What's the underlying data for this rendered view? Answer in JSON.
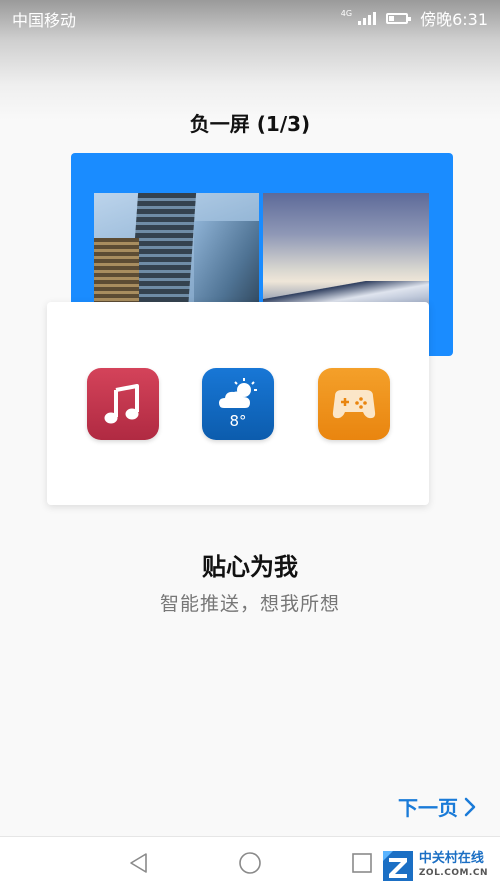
{
  "status_bar": {
    "carrier": "中国移动",
    "network_type": "4G",
    "time": "傍晚6:31",
    "battery_level": 0.3,
    "signal_bars": 4
  },
  "page": {
    "title": "负一屏 (1/3)",
    "headline": "贴心为我",
    "subline": "智能推送，想我所想",
    "next_label": "下一页",
    "accent_color": "#1a8cff"
  },
  "illustration": {
    "apps": [
      {
        "name": "music-icon",
        "color": "#c8364f"
      },
      {
        "name": "weather-icon",
        "color": "#1270cc",
        "temp": "8°"
      },
      {
        "name": "game-icon",
        "color": "#ef941c"
      }
    ]
  },
  "nav_bar": {
    "icons": [
      "back-icon",
      "home-icon",
      "recent-apps-icon"
    ]
  },
  "watermark": {
    "cn": "中关村在线",
    "en": "ZOL.COM.CN"
  }
}
